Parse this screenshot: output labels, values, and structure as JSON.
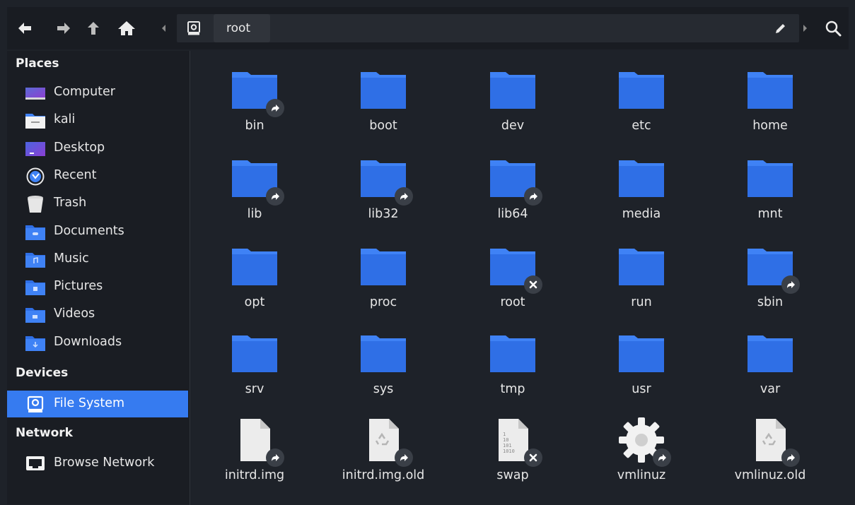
{
  "toolbar": {
    "back_icon": "arrow-left-icon",
    "forward_icon": "arrow-right-icon",
    "up_icon": "arrow-up-icon",
    "home_icon": "home-icon",
    "path_segment": "root",
    "edit_icon": "pencil-icon",
    "search_icon": "search-icon"
  },
  "sidebar": {
    "places_header": "Places",
    "places": [
      {
        "label": "Computer",
        "icon": "computer-icon"
      },
      {
        "label": "kali",
        "icon": "home-folder-icon"
      },
      {
        "label": "Desktop",
        "icon": "desktop-icon"
      },
      {
        "label": "Recent",
        "icon": "recent-icon"
      },
      {
        "label": "Trash",
        "icon": "trash-icon"
      },
      {
        "label": "Documents",
        "icon": "documents-folder-icon"
      },
      {
        "label": "Music",
        "icon": "music-folder-icon"
      },
      {
        "label": "Pictures",
        "icon": "pictures-folder-icon"
      },
      {
        "label": "Videos",
        "icon": "videos-folder-icon"
      },
      {
        "label": "Downloads",
        "icon": "downloads-folder-icon"
      }
    ],
    "devices_header": "Devices",
    "devices": [
      {
        "label": "File System",
        "icon": "drive-icon",
        "selected": true
      }
    ],
    "network_header": "Network",
    "network": [
      {
        "label": "Browse Network",
        "icon": "network-icon"
      }
    ]
  },
  "files": [
    {
      "name": "bin",
      "type": "folder",
      "badge": "link"
    },
    {
      "name": "boot",
      "type": "folder",
      "badge": ""
    },
    {
      "name": "dev",
      "type": "folder",
      "badge": ""
    },
    {
      "name": "etc",
      "type": "folder",
      "badge": ""
    },
    {
      "name": "home",
      "type": "folder",
      "badge": ""
    },
    {
      "name": "lib",
      "type": "folder",
      "badge": "link"
    },
    {
      "name": "lib32",
      "type": "folder",
      "badge": "link"
    },
    {
      "name": "lib64",
      "type": "folder",
      "badge": "link"
    },
    {
      "name": "media",
      "type": "folder",
      "badge": ""
    },
    {
      "name": "mnt",
      "type": "folder",
      "badge": ""
    },
    {
      "name": "opt",
      "type": "folder",
      "badge": ""
    },
    {
      "name": "proc",
      "type": "folder",
      "badge": ""
    },
    {
      "name": "root",
      "type": "folder",
      "badge": "locked"
    },
    {
      "name": "run",
      "type": "folder",
      "badge": ""
    },
    {
      "name": "sbin",
      "type": "folder",
      "badge": "link"
    },
    {
      "name": "srv",
      "type": "folder",
      "badge": ""
    },
    {
      "name": "sys",
      "type": "folder",
      "badge": ""
    },
    {
      "name": "tmp",
      "type": "folder",
      "badge": ""
    },
    {
      "name": "usr",
      "type": "folder",
      "badge": ""
    },
    {
      "name": "var",
      "type": "folder",
      "badge": ""
    },
    {
      "name": "initrd.img",
      "type": "file",
      "badge": "link"
    },
    {
      "name": "initrd.img.old",
      "type": "recycle-file",
      "badge": "link"
    },
    {
      "name": "swap",
      "type": "binary-file",
      "badge": "locked"
    },
    {
      "name": "vmlinuz",
      "type": "gear-file",
      "badge": "link"
    },
    {
      "name": "vmlinuz.old",
      "type": "recycle-file",
      "badge": "link"
    }
  ],
  "colors": {
    "background": "#1e2229",
    "sidebar": "#1a1d23",
    "folder": "#2f6fe6",
    "folder_tab": "#3f82f5",
    "selection": "#367bf0"
  }
}
